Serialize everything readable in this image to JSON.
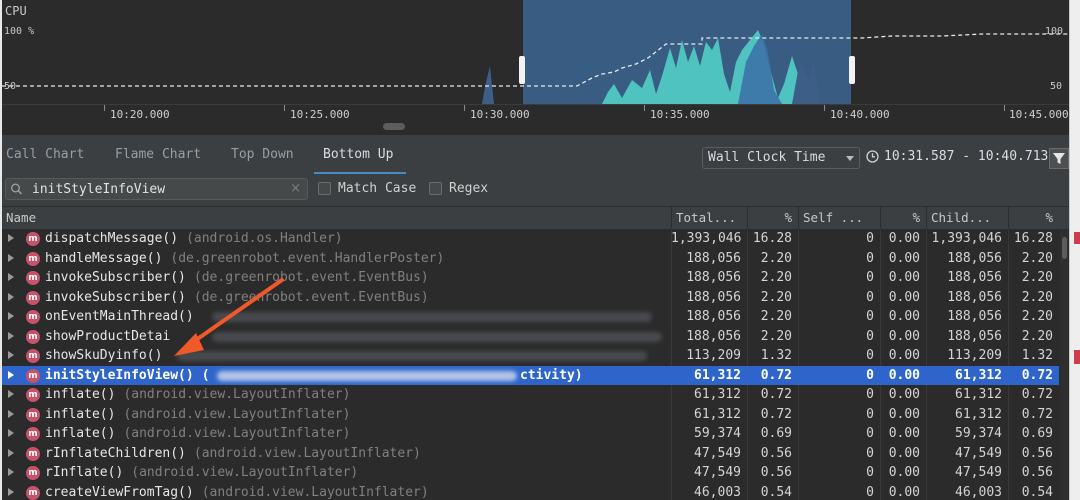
{
  "cpu": {
    "title": "CPU",
    "left_top": "100 %",
    "left_mid": "50",
    "right_top": "100",
    "right_mid": "50",
    "timeline": [
      "10:20.000",
      "10:25.000",
      "10:30.000",
      "10:35.000",
      "10:40.000",
      "10:45.000"
    ]
  },
  "tabs": [
    {
      "label": "Call Chart",
      "active": false
    },
    {
      "label": "Flame Chart",
      "active": false
    },
    {
      "label": "Top Down",
      "active": false
    },
    {
      "label": "Bottom Up",
      "active": true
    }
  ],
  "clock": {
    "selected": "Wall Clock Time"
  },
  "range": "10:31.587 - 10:40.713",
  "search": {
    "value": "initStyleInfoView",
    "match_case_label": "Match Case",
    "regex_label": "Regex"
  },
  "columns": [
    "Name",
    "Total...",
    "%",
    "Self ...",
    "%",
    "Child...",
    "%"
  ],
  "rows": [
    {
      "fn": "dispatchMessage()",
      "cls": "(android.os.Handler)",
      "total": "1,393,046",
      "tp": "16.28",
      "self": "0",
      "sp": "0.00",
      "child": "1,393,046",
      "cp": "16.28"
    },
    {
      "fn": "handleMessage()",
      "cls": "(de.greenrobot.event.HandlerPoster)",
      "total": "188,056",
      "tp": "2.20",
      "self": "0",
      "sp": "0.00",
      "child": "188,056",
      "cp": "2.20"
    },
    {
      "fn": "invokeSubscriber()",
      "cls": "(de.greenrobot.event.EventBus)",
      "total": "188,056",
      "tp": "2.20",
      "self": "0",
      "sp": "0.00",
      "child": "188,056",
      "cp": "2.20"
    },
    {
      "fn": "invokeSubscriber()",
      "cls": "(de.greenrobot.event.EventBus)",
      "total": "188,056",
      "tp": "2.20",
      "self": "0",
      "sp": "0.00",
      "child": "188,056",
      "cp": "2.20"
    },
    {
      "fn": "onEventMainThread()",
      "cls": "",
      "total": "188,056",
      "tp": "2.20",
      "self": "0",
      "sp": "0.00",
      "child": "188,056",
      "cp": "2.20"
    },
    {
      "fn": "showProductDetai",
      "cls": "",
      "total": "188,056",
      "tp": "2.20",
      "self": "0",
      "sp": "0.00",
      "child": "188,056",
      "cp": "2.20"
    },
    {
      "fn": "showSkuDyinfo()",
      "cls": "",
      "total": "113,209",
      "tp": "1.32",
      "self": "0",
      "sp": "0.00",
      "child": "113,209",
      "cp": "1.32"
    },
    {
      "fn": "initStyleInfoView()",
      "cls": "(",
      "cls_tail": "ctivity)",
      "total": "61,312",
      "tp": "0.72",
      "self": "0",
      "sp": "0.00",
      "child": "61,312",
      "cp": "0.72",
      "selected": true
    },
    {
      "fn": "inflate()",
      "cls": "(android.view.LayoutInflater)",
      "total": "61,312",
      "tp": "0.72",
      "self": "0",
      "sp": "0.00",
      "child": "61,312",
      "cp": "0.72"
    },
    {
      "fn": "inflate()",
      "cls": "(android.view.LayoutInflater)",
      "total": "61,312",
      "tp": "0.72",
      "self": "0",
      "sp": "0.00",
      "child": "61,312",
      "cp": "0.72"
    },
    {
      "fn": "inflate()",
      "cls": "(android.view.LayoutInflater)",
      "total": "59,374",
      "tp": "0.69",
      "self": "0",
      "sp": "0.00",
      "child": "59,374",
      "cp": "0.69"
    },
    {
      "fn": "rInflateChildren()",
      "cls": "(android.view.LayoutInflater)",
      "total": "47,549",
      "tp": "0.56",
      "self": "0",
      "sp": "0.00",
      "child": "47,549",
      "cp": "0.56"
    },
    {
      "fn": "rInflate()",
      "cls": "(android.view.LayoutInflater)",
      "total": "47,549",
      "tp": "0.56",
      "self": "0",
      "sp": "0.00",
      "child": "47,549",
      "cp": "0.56"
    },
    {
      "fn": "createViewFromTag()",
      "cls": "(android.view.LayoutInflater)",
      "total": "46,003",
      "tp": "0.54",
      "self": "0",
      "sp": "0.00",
      "child": "46,003",
      "cp": "0.54"
    }
  ],
  "icons": {
    "method": "m"
  },
  "colors": {
    "selection": "#2f65ca",
    "accent": "#4a88c7",
    "cpu_fill": "#4fc3c0",
    "method_icon": "#c7536b",
    "annotation_arrow": "#f0592a"
  }
}
